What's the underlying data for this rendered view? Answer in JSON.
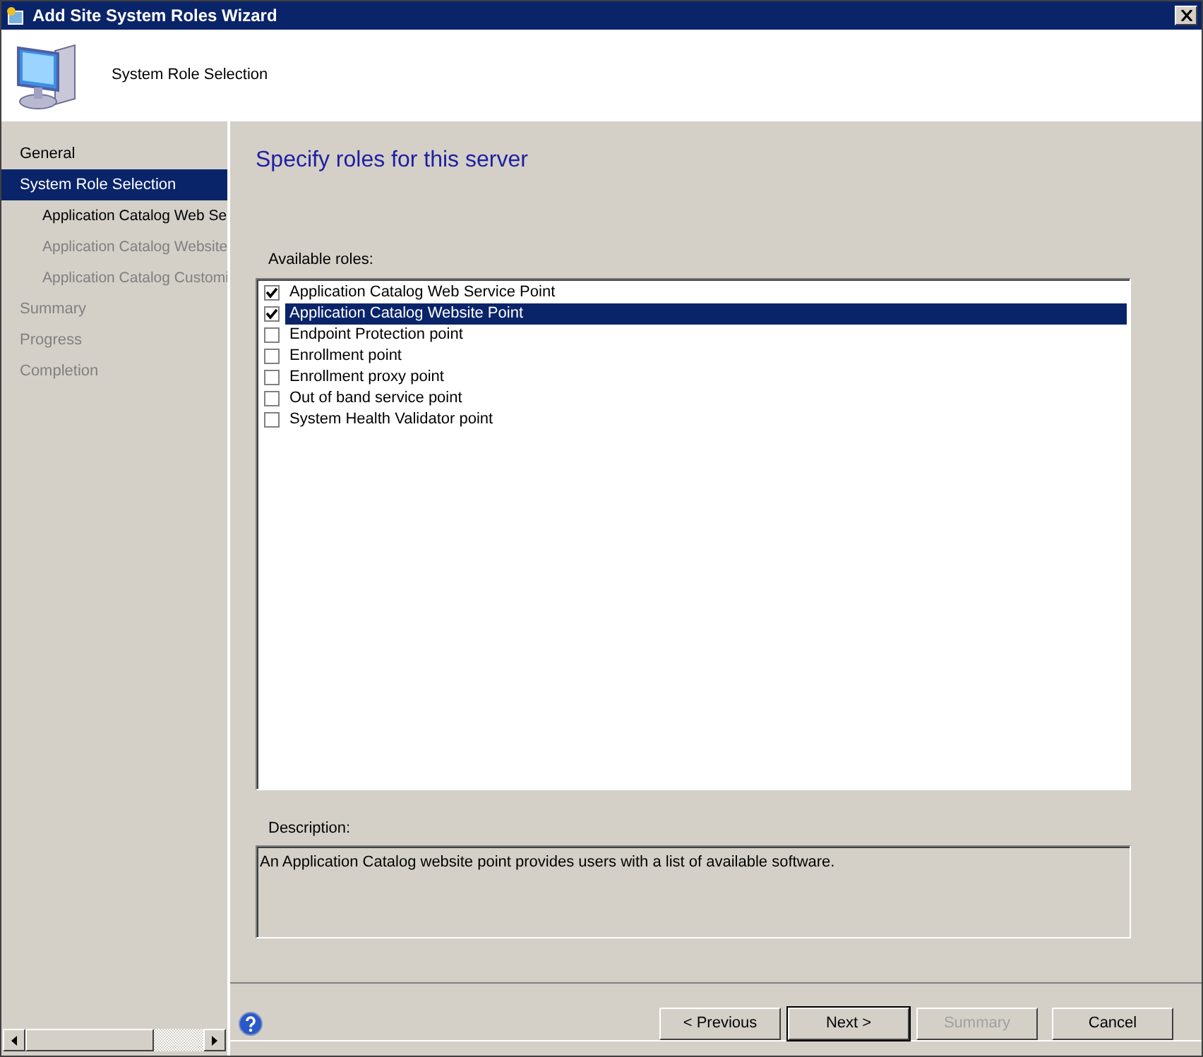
{
  "window": {
    "title": "Add Site System Roles Wizard"
  },
  "header": {
    "title": "System Role Selection"
  },
  "sidebar": {
    "items": [
      {
        "label": "General",
        "selected": false,
        "disabled": false
      },
      {
        "label": "System Role Selection",
        "selected": true,
        "disabled": false,
        "children": [
          {
            "label": "Application Catalog Web Se",
            "selected": false,
            "disabled": false
          },
          {
            "label": "Application Catalog Website",
            "selected": false,
            "disabled": true
          },
          {
            "label": "Application Catalog Customi",
            "selected": false,
            "disabled": true
          }
        ]
      },
      {
        "label": "Summary",
        "selected": false,
        "disabled": true
      },
      {
        "label": "Progress",
        "selected": false,
        "disabled": true
      },
      {
        "label": "Completion",
        "selected": false,
        "disabled": true
      }
    ]
  },
  "page": {
    "heading": "Specify roles for this server",
    "roles_label": "Available roles:",
    "roles": [
      {
        "label": "Application Catalog Web Service Point",
        "checked": true,
        "selected": false
      },
      {
        "label": "Application Catalog Website Point",
        "checked": true,
        "selected": true
      },
      {
        "label": "Endpoint Protection point",
        "checked": false,
        "selected": false
      },
      {
        "label": "Enrollment point",
        "checked": false,
        "selected": false
      },
      {
        "label": "Enrollment proxy point",
        "checked": false,
        "selected": false
      },
      {
        "label": "Out of band service point",
        "checked": false,
        "selected": false
      },
      {
        "label": "System Health Validator point",
        "checked": false,
        "selected": false
      }
    ],
    "description_label": "Description:",
    "description": "An Application Catalog website point provides users with a list of available software."
  },
  "buttons": [
    {
      "label": "< Previous",
      "disabled": false,
      "default": false
    },
    {
      "label": "Next >",
      "disabled": false,
      "default": true
    },
    {
      "label": "Summary",
      "disabled": true,
      "default": false
    },
    {
      "label": "Cancel",
      "disabled": false,
      "default": false
    }
  ]
}
